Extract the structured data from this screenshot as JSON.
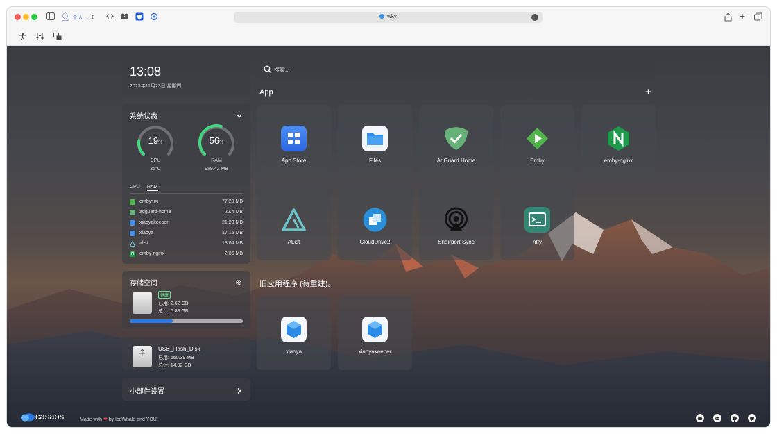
{
  "browser": {
    "profile_label": "个人",
    "address": "wky"
  },
  "clock": {
    "time": "13:08",
    "date": "2023年11月23日 星期四"
  },
  "system": {
    "title": "系统状态",
    "cpu": {
      "percent": 19,
      "unit": "%",
      "label": "CPU",
      "sub": "35°C"
    },
    "ram": {
      "percent": 56,
      "unit": "%",
      "label": "RAM",
      "sub": "989.42 MB"
    },
    "tabs": [
      "CPU",
      "RAM"
    ],
    "active_tab": "RAM",
    "processes": [
      {
        "name": "emby",
        "value": "77.29 MB",
        "color": "#52b54b"
      },
      {
        "name": "adguard-home",
        "value": "22.4 MB",
        "color": "#67b279"
      },
      {
        "name": "xiaoyakeeper",
        "value": "21.23 MB",
        "color": "#4a90e2"
      },
      {
        "name": "xiaoya",
        "value": "17.15 MB",
        "color": "#4a90e2"
      },
      {
        "name": "alist",
        "value": "13.04 MB",
        "color": "#6cc4c9"
      },
      {
        "name": "emby-nginx",
        "value": "2.86 MB",
        "color": "#1f9a4c"
      }
    ]
  },
  "storage": {
    "title": "存储空间",
    "badge": "健康",
    "used": "已用: 2.62 GB",
    "total": "总计: 6.88 GB",
    "used_fraction": 0.38
  },
  "usb": {
    "name": "USB_Flash_Disk",
    "used": "已用: 660.39 MB",
    "total": "总计: 14.92 GB"
  },
  "widget_settings": {
    "label": "小部件设置"
  },
  "search": {
    "placeholder": "搜索..."
  },
  "apps_section": {
    "title": "App"
  },
  "apps": [
    {
      "name": "App Store",
      "icon": "app-store-icon"
    },
    {
      "name": "Files",
      "icon": "files-icon"
    },
    {
      "name": "AdGuard Home",
      "icon": "adguard-icon"
    },
    {
      "name": "Emby",
      "icon": "emby-icon"
    },
    {
      "name": "emby-nginx",
      "icon": "nginx-icon"
    },
    {
      "name": "AList",
      "icon": "alist-icon"
    },
    {
      "name": "CloudDrive2",
      "icon": "clouddrive-icon"
    },
    {
      "name": "Shairport Sync",
      "icon": "airplay-icon"
    },
    {
      "name": "ntfy",
      "icon": "ntfy-icon"
    }
  ],
  "legacy_section": {
    "title": "旧应用程序 (待重建)。"
  },
  "legacy_apps": [
    {
      "name": "xiaoya",
      "icon": "xiaoya-icon"
    },
    {
      "name": "xiaoyakeeper",
      "icon": "xiaoyakeeper-icon"
    }
  ],
  "footer": {
    "brand": "casaos",
    "made_with_prefix": "Made with",
    "made_with_suffix": "by IceWhale and YOU!"
  },
  "colors": {
    "accent_green": "#3fd97f",
    "accent_blue": "#2a7ae4",
    "traffic_red": "#ff5f57",
    "traffic_yellow": "#febc2e",
    "traffic_green": "#28c840"
  }
}
